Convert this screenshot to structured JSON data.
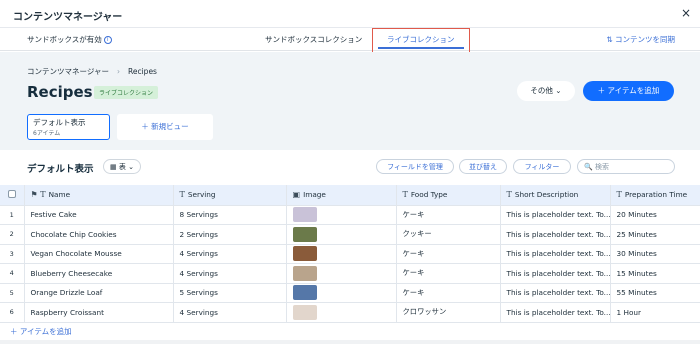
{
  "window": {
    "title": "コンテンツマネージャー",
    "close": "×"
  },
  "subbar": {
    "sandbox_label": "サンドボックスが有効",
    "tab_sandbox": "サンドボックスコレクション",
    "tab_live": "ライブコレクション",
    "sync": "⇅ コンテンツを同期"
  },
  "header": {
    "breadcrumb_root": "コンテンツマネージャー",
    "breadcrumb_current": "Recipes",
    "title": "Recipes",
    "badge": "ライブコレクション",
    "more": "その他 ⌄",
    "add_item": "＋ アイテムを追加"
  },
  "views": {
    "default_name": "デフォルト表示",
    "default_count": "6アイテム",
    "new_view": "＋ 新規ビュー"
  },
  "toolbar": {
    "view_title": "デフォルト表示",
    "layout": "▦ 表 ⌄",
    "manage_fields": "フィールドを管理",
    "sort": "並び替え",
    "filter": "フィルター",
    "search_placeholder": "🔍 検索"
  },
  "table": {
    "columns": [
      "Name",
      "Serving",
      "Image",
      "Food Type",
      "Short Description",
      "Preparation Time"
    ],
    "rows": [
      {
        "n": "1",
        "name": "Festive Cake",
        "serving": "8 Servings",
        "type": "ケーキ",
        "desc": "This is placeholder text. To...",
        "time": "20 Minutes",
        "img": "#c9c2d8"
      },
      {
        "n": "2",
        "name": "Chocolate Chip Cookies",
        "serving": "2 Servings",
        "type": "クッキー",
        "desc": "This is placeholder text. To...",
        "time": "25 Minutes",
        "img": "#6b7a4a"
      },
      {
        "n": "3",
        "name": "Vegan Chocolate Mousse",
        "serving": "4 Servings",
        "type": "ケーキ",
        "desc": "This is placeholder text. To...",
        "time": "30 Minutes",
        "img": "#8a5b3a"
      },
      {
        "n": "4",
        "name": "Blueberry Cheesecake",
        "serving": "4 Servings",
        "type": "ケーキ",
        "desc": "This is placeholder text. To...",
        "time": "15 Minutes",
        "img": "#b9a48c"
      },
      {
        "n": "5",
        "name": "Orange Drizzle Loaf",
        "serving": "5 Servings",
        "type": "ケーキ",
        "desc": "This is placeholder text. To...",
        "time": "55 Minutes",
        "img": "#5577a8"
      },
      {
        "n": "6",
        "name": "Raspberry Croissant",
        "serving": "4 Servings",
        "type": "クロワッサン",
        "desc": "This is placeholder text. To...",
        "time": "1 Hour",
        "img": "#e2d6cc"
      }
    ],
    "add_row": "＋ アイテムを追加"
  }
}
